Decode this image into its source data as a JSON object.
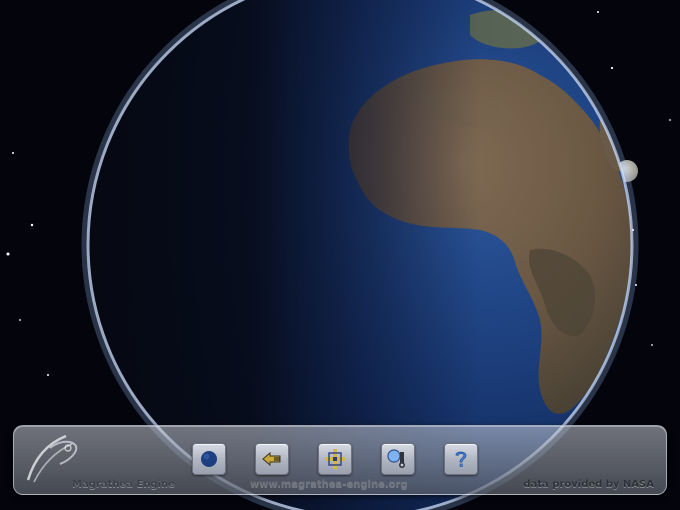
{
  "toolbar": {
    "engine_label": "Magrathea Engine",
    "url_label": "www.magrathea-engine.org",
    "credit_label": "data provided by NASA",
    "buttons": [
      {
        "name": "view-earth-button",
        "icon": "earth-icon"
      },
      {
        "name": "rotate-button",
        "icon": "arrow-left-icon"
      },
      {
        "name": "navigate-button",
        "icon": "crosshair-move-icon"
      },
      {
        "name": "zoom-button",
        "icon": "magnifier-icon"
      },
      {
        "name": "help-button",
        "icon": "question-icon"
      }
    ]
  },
  "colors": {
    "ocean": "#1c3d7a",
    "land": "#6e5a44",
    "atmosphere": "#9ec4ff",
    "space": "#03040c"
  }
}
